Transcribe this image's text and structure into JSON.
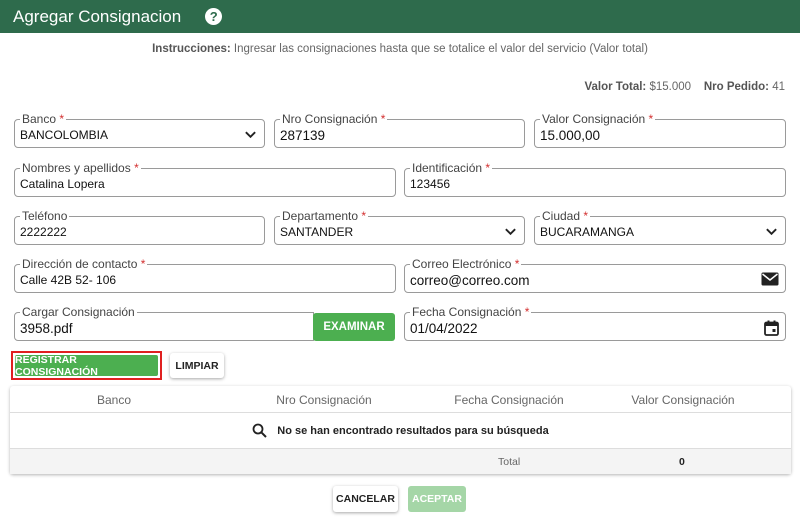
{
  "header": {
    "title": "Agregar Consignacion",
    "help_icon": "?"
  },
  "instructions": {
    "label": "Instrucciones:",
    "text": " Ingresar las consignaciones hasta que se totalice el valor del servicio (Valor total)"
  },
  "totals": {
    "valor_total_label": "Valor Total:",
    "valor_total": "$15.000",
    "nro_pedido_label": "Nro Pedido:",
    "nro_pedido": "41"
  },
  "form": {
    "banco": {
      "label": "Banco",
      "required": "*",
      "value": "BANCOLOMBIA"
    },
    "nro_consignacion": {
      "label": "Nro Consignación",
      "required": "*",
      "value": "287139"
    },
    "valor_consignacion": {
      "label": "Valor Consignación",
      "required": "*",
      "value": "15.000,00"
    },
    "nombres": {
      "label": "Nombres y apellidos",
      "required": "*",
      "value": "Catalina Lopera"
    },
    "identificacion": {
      "label": "Identificación",
      "required": "*",
      "value": "123456"
    },
    "telefono": {
      "label": "Teléfono",
      "value": "2222222"
    },
    "departamento": {
      "label": "Departamento",
      "required": "*",
      "value": "SANTANDER"
    },
    "ciudad": {
      "label": "Ciudad",
      "required": "*",
      "value": "BUCARAMANGA"
    },
    "direccion": {
      "label": "Dirección de contacto",
      "required": "*",
      "value": "Calle 42B 52- 106"
    },
    "correo": {
      "label": "Correo Electrónico",
      "required": "*",
      "value": "correo@correo.com",
      "icon": "envelope-icon"
    },
    "cargar": {
      "label": "Cargar Consignación",
      "value": "3958.pdf",
      "button": "EXAMINAR"
    },
    "fecha": {
      "label": "Fecha Consignación",
      "required": "*",
      "value": "01/04/2022",
      "icon": "calendar-icon"
    }
  },
  "actions": {
    "registrar": "REGISTRAR CONSIGNACIÓN",
    "limpiar": "LIMPIAR"
  },
  "table": {
    "columns": [
      "Banco",
      "Nro Consignación",
      "Fecha Consignación",
      "Valor Consignación"
    ],
    "empty_message": "No se han encontrado resultados para su búsqueda",
    "total_label": "Total",
    "total_value": "0"
  },
  "footer": {
    "cancelar": "CANCELAR",
    "aceptar": "ACEPTAR"
  },
  "colors": {
    "header": "#2e6b4c",
    "primary_button": "#4caf50",
    "disabled_button": "#a5d6a7",
    "required": "#d32f2f",
    "highlight": "#e02020"
  }
}
